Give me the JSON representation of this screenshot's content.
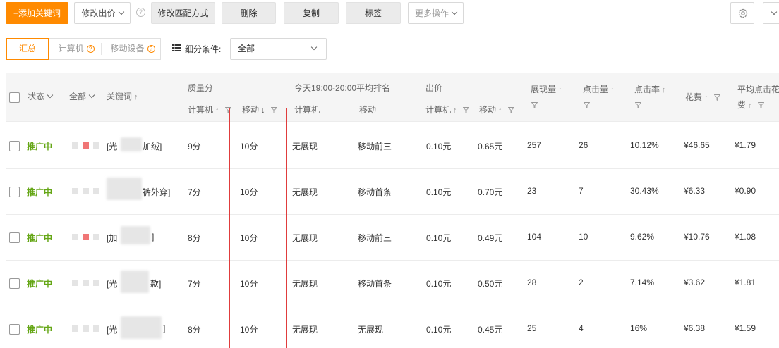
{
  "toolbar": {
    "add_keyword": "+添加关键词",
    "modify_bid": "修改出价",
    "modify_match": "修改匹配方式",
    "delete": "删除",
    "copy": "复制",
    "tag": "标签",
    "more_ops": "更多操作"
  },
  "filters": {
    "segments": [
      "汇总",
      "计算机",
      "移动设备"
    ],
    "condition_label": "细分条件:",
    "condition_value": "全部"
  },
  "table": {
    "headers": {
      "status": "状态",
      "all": "全部",
      "keyword": "关键词",
      "quality": "质量分",
      "quality_pc": "计算机",
      "quality_mobile": "移动",
      "rank_group": "今天19:00-20:00平均排名",
      "rank_pc": "计算机",
      "rank_mobile": "移动",
      "bid": "出价",
      "bid_pc": "计算机",
      "bid_mobile": "移动",
      "impressions": "展现量",
      "clicks": "点击量",
      "ctr": "点击率",
      "cost": "花费",
      "avg_cpc_line1": "平均点击花",
      "avg_cpc_line2": "费"
    },
    "rows": [
      {
        "status": "推广中",
        "keyword_a": "[光",
        "keyword_b": "加绒]",
        "q_pc": "9分",
        "q_mobile": "10分",
        "rank_pc": "无展现",
        "rank_mobile": "移动前三",
        "bid_pc": "0.10元",
        "bid_mobile": "0.65元",
        "impressions": "257",
        "clicks": "26",
        "ctr": "10.12%",
        "cost": "¥46.65",
        "cpc": "¥1.79",
        "flag": "red"
      },
      {
        "status": "推广中",
        "keyword_a": "",
        "keyword_b": "裤外穿]",
        "q_pc": "7分",
        "q_mobile": "10分",
        "rank_pc": "无展现",
        "rank_mobile": "移动首条",
        "bid_pc": "0.10元",
        "bid_mobile": "0.70元",
        "impressions": "23",
        "clicks": "7",
        "ctr": "30.43%",
        "cost": "¥6.33",
        "cpc": "¥0.90",
        "flag": "gray"
      },
      {
        "status": "推广中",
        "keyword_a": "[加",
        "keyword_b": "]",
        "q_pc": "8分",
        "q_mobile": "10分",
        "rank_pc": "无展现",
        "rank_mobile": "移动前三",
        "bid_pc": "0.10元",
        "bid_mobile": "0.49元",
        "impressions": "104",
        "clicks": "10",
        "ctr": "9.62%",
        "cost": "¥10.76",
        "cpc": "¥1.08",
        "flag": "red"
      },
      {
        "status": "推广中",
        "keyword_a": "[光",
        "keyword_b": "款]",
        "q_pc": "7分",
        "q_mobile": "10分",
        "rank_pc": "无展现",
        "rank_mobile": "移动首条",
        "bid_pc": "0.10元",
        "bid_mobile": "0.50元",
        "impressions": "28",
        "clicks": "2",
        "ctr": "7.14%",
        "cost": "¥3.62",
        "cpc": "¥1.81",
        "flag": "gray"
      },
      {
        "status": "推广中",
        "keyword_a": "[光",
        "keyword_b": "]",
        "q_pc": "8分",
        "q_mobile": "10分",
        "rank_pc": "无展现",
        "rank_mobile": "无展现",
        "bid_pc": "0.10元",
        "bid_mobile": "0.45元",
        "impressions": "25",
        "clicks": "4",
        "ctr": "16%",
        "cost": "¥6.38",
        "cpc": "¥1.59",
        "flag": "gray"
      }
    ]
  },
  "colors": {
    "accent": "#ff8a00",
    "status_green": "#65a616",
    "highlight_red": "#e03c3c"
  }
}
